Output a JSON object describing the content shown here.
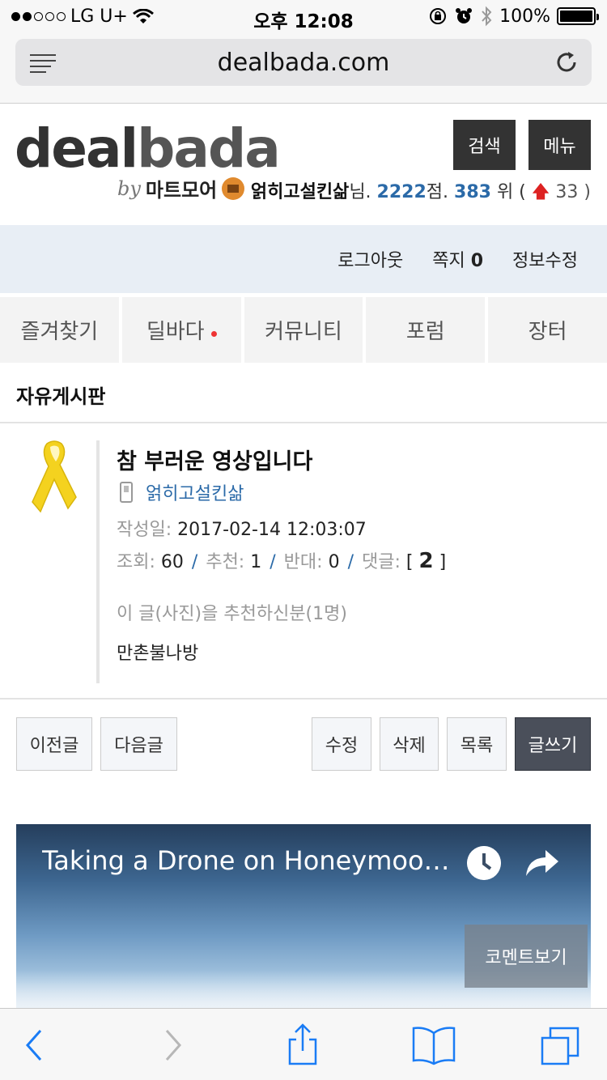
{
  "status_bar": {
    "carrier": "LG U+",
    "time": "오후 12:08",
    "battery": "100%",
    "signal_bars_filled": 2,
    "signal_bars_total": 5
  },
  "browser": {
    "url": "dealbada.com"
  },
  "header": {
    "logo_text_dark": "deal",
    "logo_text_light": "bada",
    "logo_by": "by",
    "logo_partner": "마트모어",
    "search_label": "검색",
    "menu_label": "메뉴",
    "user": {
      "nickname": "얽히고설킨삶",
      "suffix": "님.",
      "points": "2222",
      "points_unit": "점.",
      "rank": "383",
      "rank_unit": "위 (",
      "rank_change": "33",
      "close": ")"
    }
  },
  "account_bar": {
    "logout": "로그아웃",
    "messages": "쪽지",
    "message_count": "0",
    "edit_info": "정보수정"
  },
  "nav_tabs": [
    {
      "label": "즐겨찾기"
    },
    {
      "label": "딜바다"
    },
    {
      "label": "커뮤니티"
    },
    {
      "label": "포럼"
    },
    {
      "label": "장터"
    }
  ],
  "board": {
    "title": "자유게시판"
  },
  "post": {
    "title": "참 부러운 영상입니다",
    "author": "얽히고설킨삶",
    "date_label": "작성일:",
    "date": "2017-02-14 12:03:07",
    "views_label": "조회:",
    "views": "60",
    "recommend_label": "추천:",
    "recommend": "1",
    "oppose_label": "반대:",
    "oppose": "0",
    "comments_label": "댓글:",
    "comments": "2",
    "recommenders_title": "이 글(사진)을 추천하신분(1명)",
    "recommenders": "만촌불나방"
  },
  "actions": {
    "prev": "이전글",
    "next": "다음글",
    "edit": "수정",
    "delete": "삭제",
    "list": "목록",
    "write": "글쓰기"
  },
  "video": {
    "title": "Taking a Drone on Honeymoo…",
    "comments_button": "코멘트보기"
  },
  "colors": {
    "accent_blue": "#2b6aa8",
    "dark_button": "#333333",
    "account_bar_bg": "#e8eef5",
    "ios_blue": "#1a7cf5"
  }
}
